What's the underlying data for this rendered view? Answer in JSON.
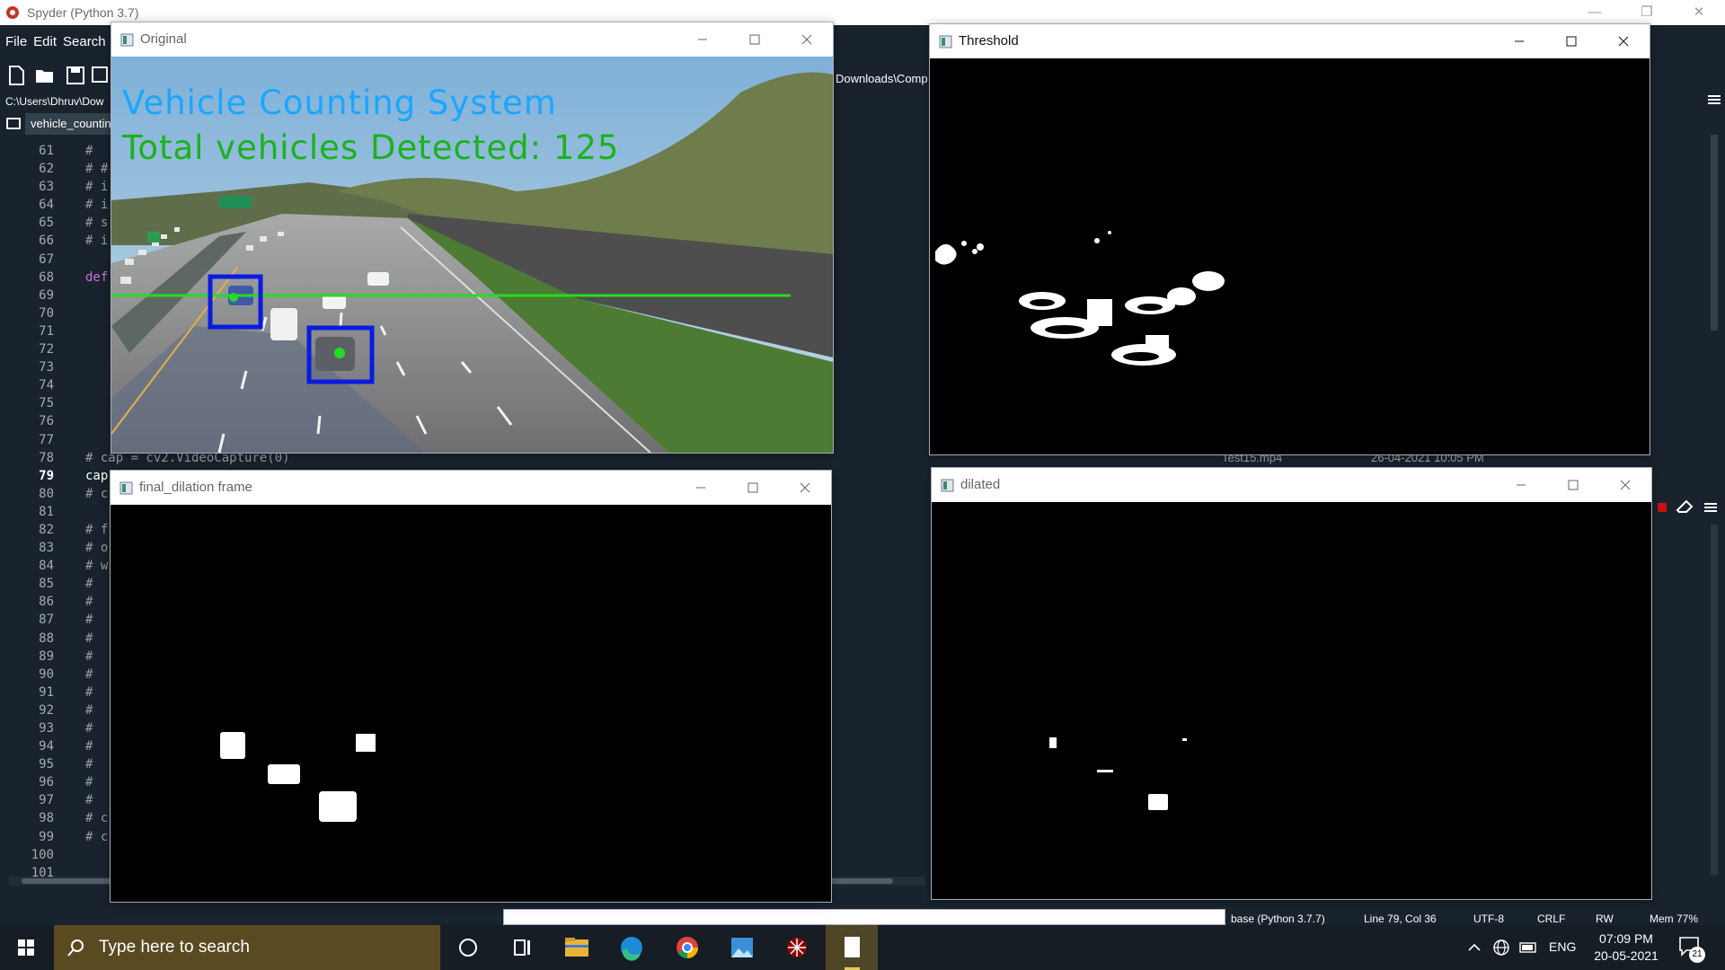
{
  "spyder": {
    "title": "Spyder (Python 3.7)",
    "menu": [
      "File",
      "Edit",
      "Search"
    ],
    "path_left": "C:\\Users\\Dhruv\\Dow",
    "path_right": "Downloads\\Comp",
    "file_tab": "vehicle_counting",
    "line_numbers": [
      "61",
      "62",
      "63",
      "64",
      "65",
      "66",
      "67",
      "68",
      "69",
      "70",
      "71",
      "72",
      "73",
      "74",
      "75",
      "76",
      "77",
      "78",
      "79",
      "80",
      "81",
      "82",
      "83",
      "84",
      "85",
      "86",
      "87",
      "88",
      "89",
      "90",
      "91",
      "92",
      "93",
      "94",
      "95",
      "96",
      "97",
      "98",
      "99",
      "100",
      "101"
    ],
    "current_line": "79",
    "code_lines": [
      "#",
      "# #",
      "# i",
      "# i",
      "# s",
      "# i",
      "",
      "def",
      "",
      "",
      "",
      "",
      "",
      "",
      "",
      "",
      "",
      "# cap = cv2.VideoCapture(0)",
      "cap",
      "# c",
      "",
      "# f",
      "# o",
      "# w",
      "#",
      "#",
      "#",
      "#",
      "#",
      "#",
      "#",
      "#",
      "#",
      "#",
      "#",
      "#",
      "#",
      "# c",
      "# c",
      "",
      ""
    ],
    "file_row": {
      "name": "Test15.mp4",
      "date": "26-04-2021 10:05 PM"
    },
    "status": {
      "env": "base (Python 3.7.7)",
      "position": "Line 79, Col 36",
      "encoding": "UTF-8",
      "eol": "CRLF",
      "rw": "RW",
      "mem": "Mem 77%"
    }
  },
  "windows": {
    "original": {
      "title": "Original",
      "overlay_title": "Vehicle Counting System",
      "overlay_count": "Total vehicles Detected: 125"
    },
    "threshold": {
      "title": "Threshold"
    },
    "final_dilation": {
      "title": "final_dilation frame"
    },
    "dilated": {
      "title": "dilated"
    }
  },
  "taskbar": {
    "search_placeholder": "Type here to search",
    "language": "ENG",
    "time": "07:09 PM",
    "date": "20-05-2021",
    "notifications": "21"
  },
  "colors": {
    "overlay_title": "#1aa7ff",
    "overlay_count": "#1bb21b",
    "detection_box": "#0a1be0",
    "count_line": "#22dd22",
    "spyder_bg": "#19232d"
  }
}
